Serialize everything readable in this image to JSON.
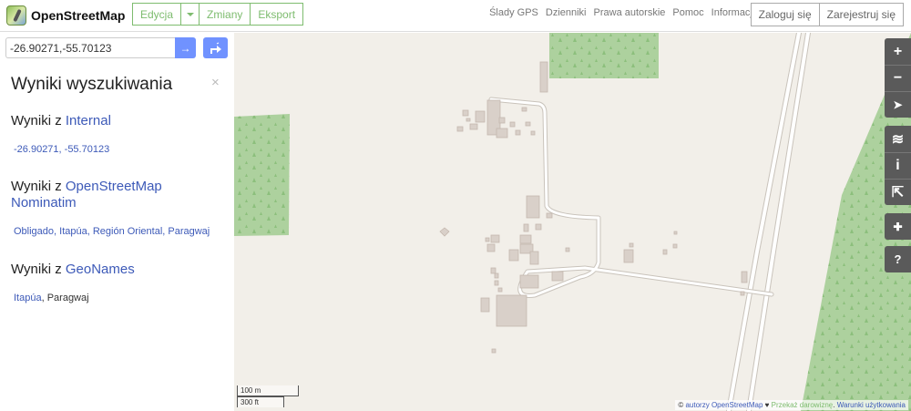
{
  "header": {
    "brand": "OpenStreetMap",
    "edit_label": "Edycja",
    "changes_label": "Zmiany",
    "export_label": "Eksport",
    "nav": [
      "Ślady GPS",
      "Dzienniki",
      "Prawa autorskie",
      "Pomoc",
      "Informacje"
    ],
    "login_label": "Zaloguj się",
    "signup_label": "Zarejestruj się",
    "accent": "#7ebc6f"
  },
  "search": {
    "value": "-26.90271,-55.70123",
    "go_label": "→"
  },
  "sidebar": {
    "title": "Wyniki wyszukiwania",
    "close": "×",
    "sections": [
      {
        "prefix": "Wyniki z",
        "source": "Internal",
        "results": [
          {
            "link": "-26.90271, -55.70123",
            "rest": ""
          }
        ]
      },
      {
        "prefix": "Wyniki z",
        "source": "OpenStreetMap Nominatim",
        "results": [
          {
            "link": "Obligado, Itapúa, Región Oriental, Paragwaj",
            "rest": ""
          }
        ]
      },
      {
        "prefix": "Wyniki z",
        "source": "GeoNames",
        "results": [
          {
            "link": "Itapúa",
            "rest": ", Paragwaj"
          }
        ]
      }
    ]
  },
  "map": {
    "colors": {
      "land": "#f2efe9",
      "wood": "#add19e",
      "building": "#d9d0c9",
      "road": "#ffffff"
    },
    "controls": {
      "zoom_in": "+",
      "zoom_out": "−",
      "locate": "➤",
      "layers": "≋",
      "info": "i",
      "share": "⇱",
      "note": "✚",
      "query": "?"
    },
    "scale": {
      "metric": "100 m",
      "imperial": "300 ft"
    },
    "attribution": {
      "prefix": "©",
      "authors": "autorzy OpenStreetMap",
      "heart": "♥",
      "donate": "Przekaż darowiznę",
      "dot": ".",
      "terms": "Warunki użytkowania"
    }
  }
}
